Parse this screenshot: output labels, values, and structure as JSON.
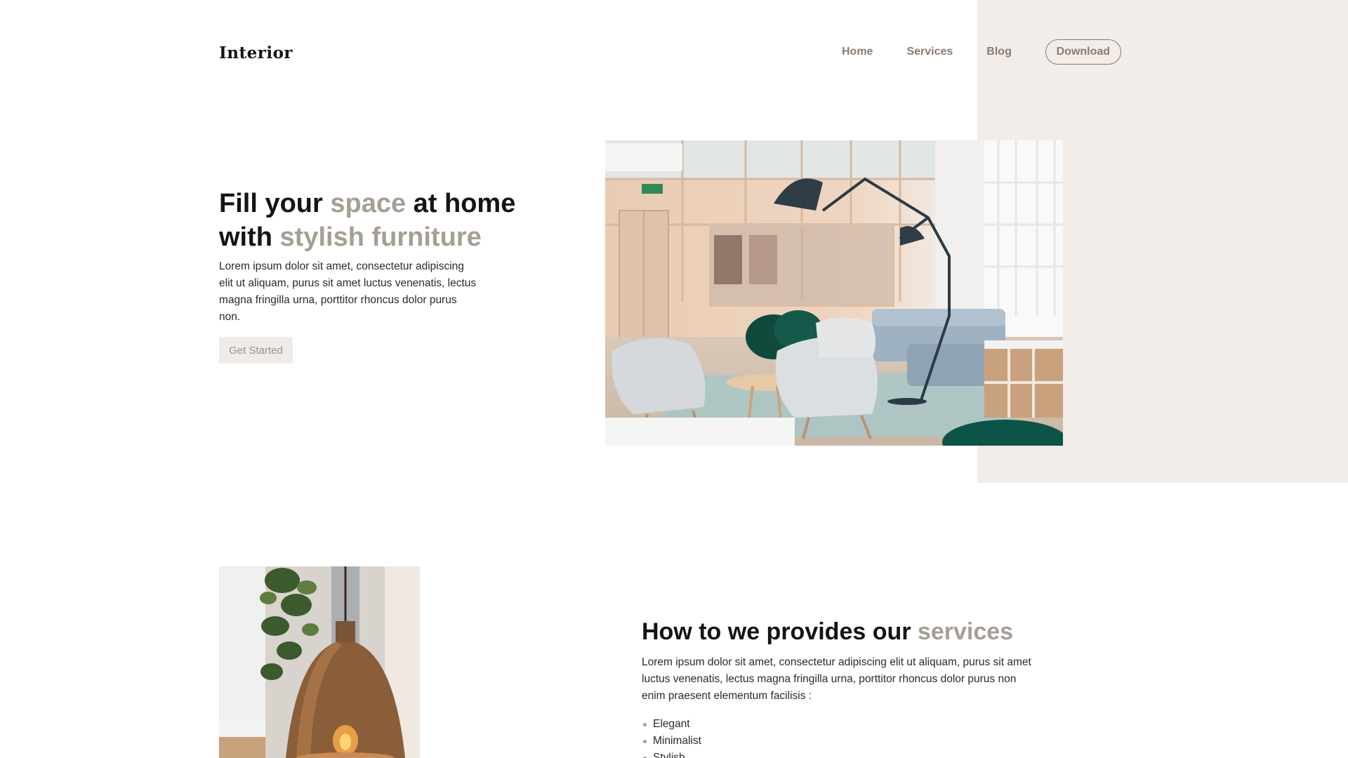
{
  "header": {
    "logo": "Interior",
    "nav": [
      "Home",
      "Services",
      "Blog"
    ],
    "download_label": "Download"
  },
  "hero": {
    "title_part1": "Fill your ",
    "title_accent1": "space",
    "title_part2": " at home with ",
    "title_accent2": "stylish furniture",
    "description": "Lorem ipsum dolor sit amet, consectetur adipiscing elit ut aliquam, purus sit amet luctus venenatis, lectus magna fringilla urna, porttitor rhoncus dolor purus non.",
    "cta_label": "Get Started"
  },
  "services": {
    "title_part1": "How to we provides our ",
    "title_accent": "services",
    "description": "Lorem ipsum dolor sit amet, consectetur adipiscing elit ut aliquam, purus sit amet luctus venenatis, lectus magna fringilla urna, porttitor rhoncus dolor purus non enim praesent elementum facilisis :",
    "features": [
      "Elegant",
      "Minimalist",
      "Stylish"
    ]
  },
  "colors": {
    "accent": "#a59f94",
    "nav_text": "#8a7b73",
    "beige_panel": "#f2ede8"
  }
}
